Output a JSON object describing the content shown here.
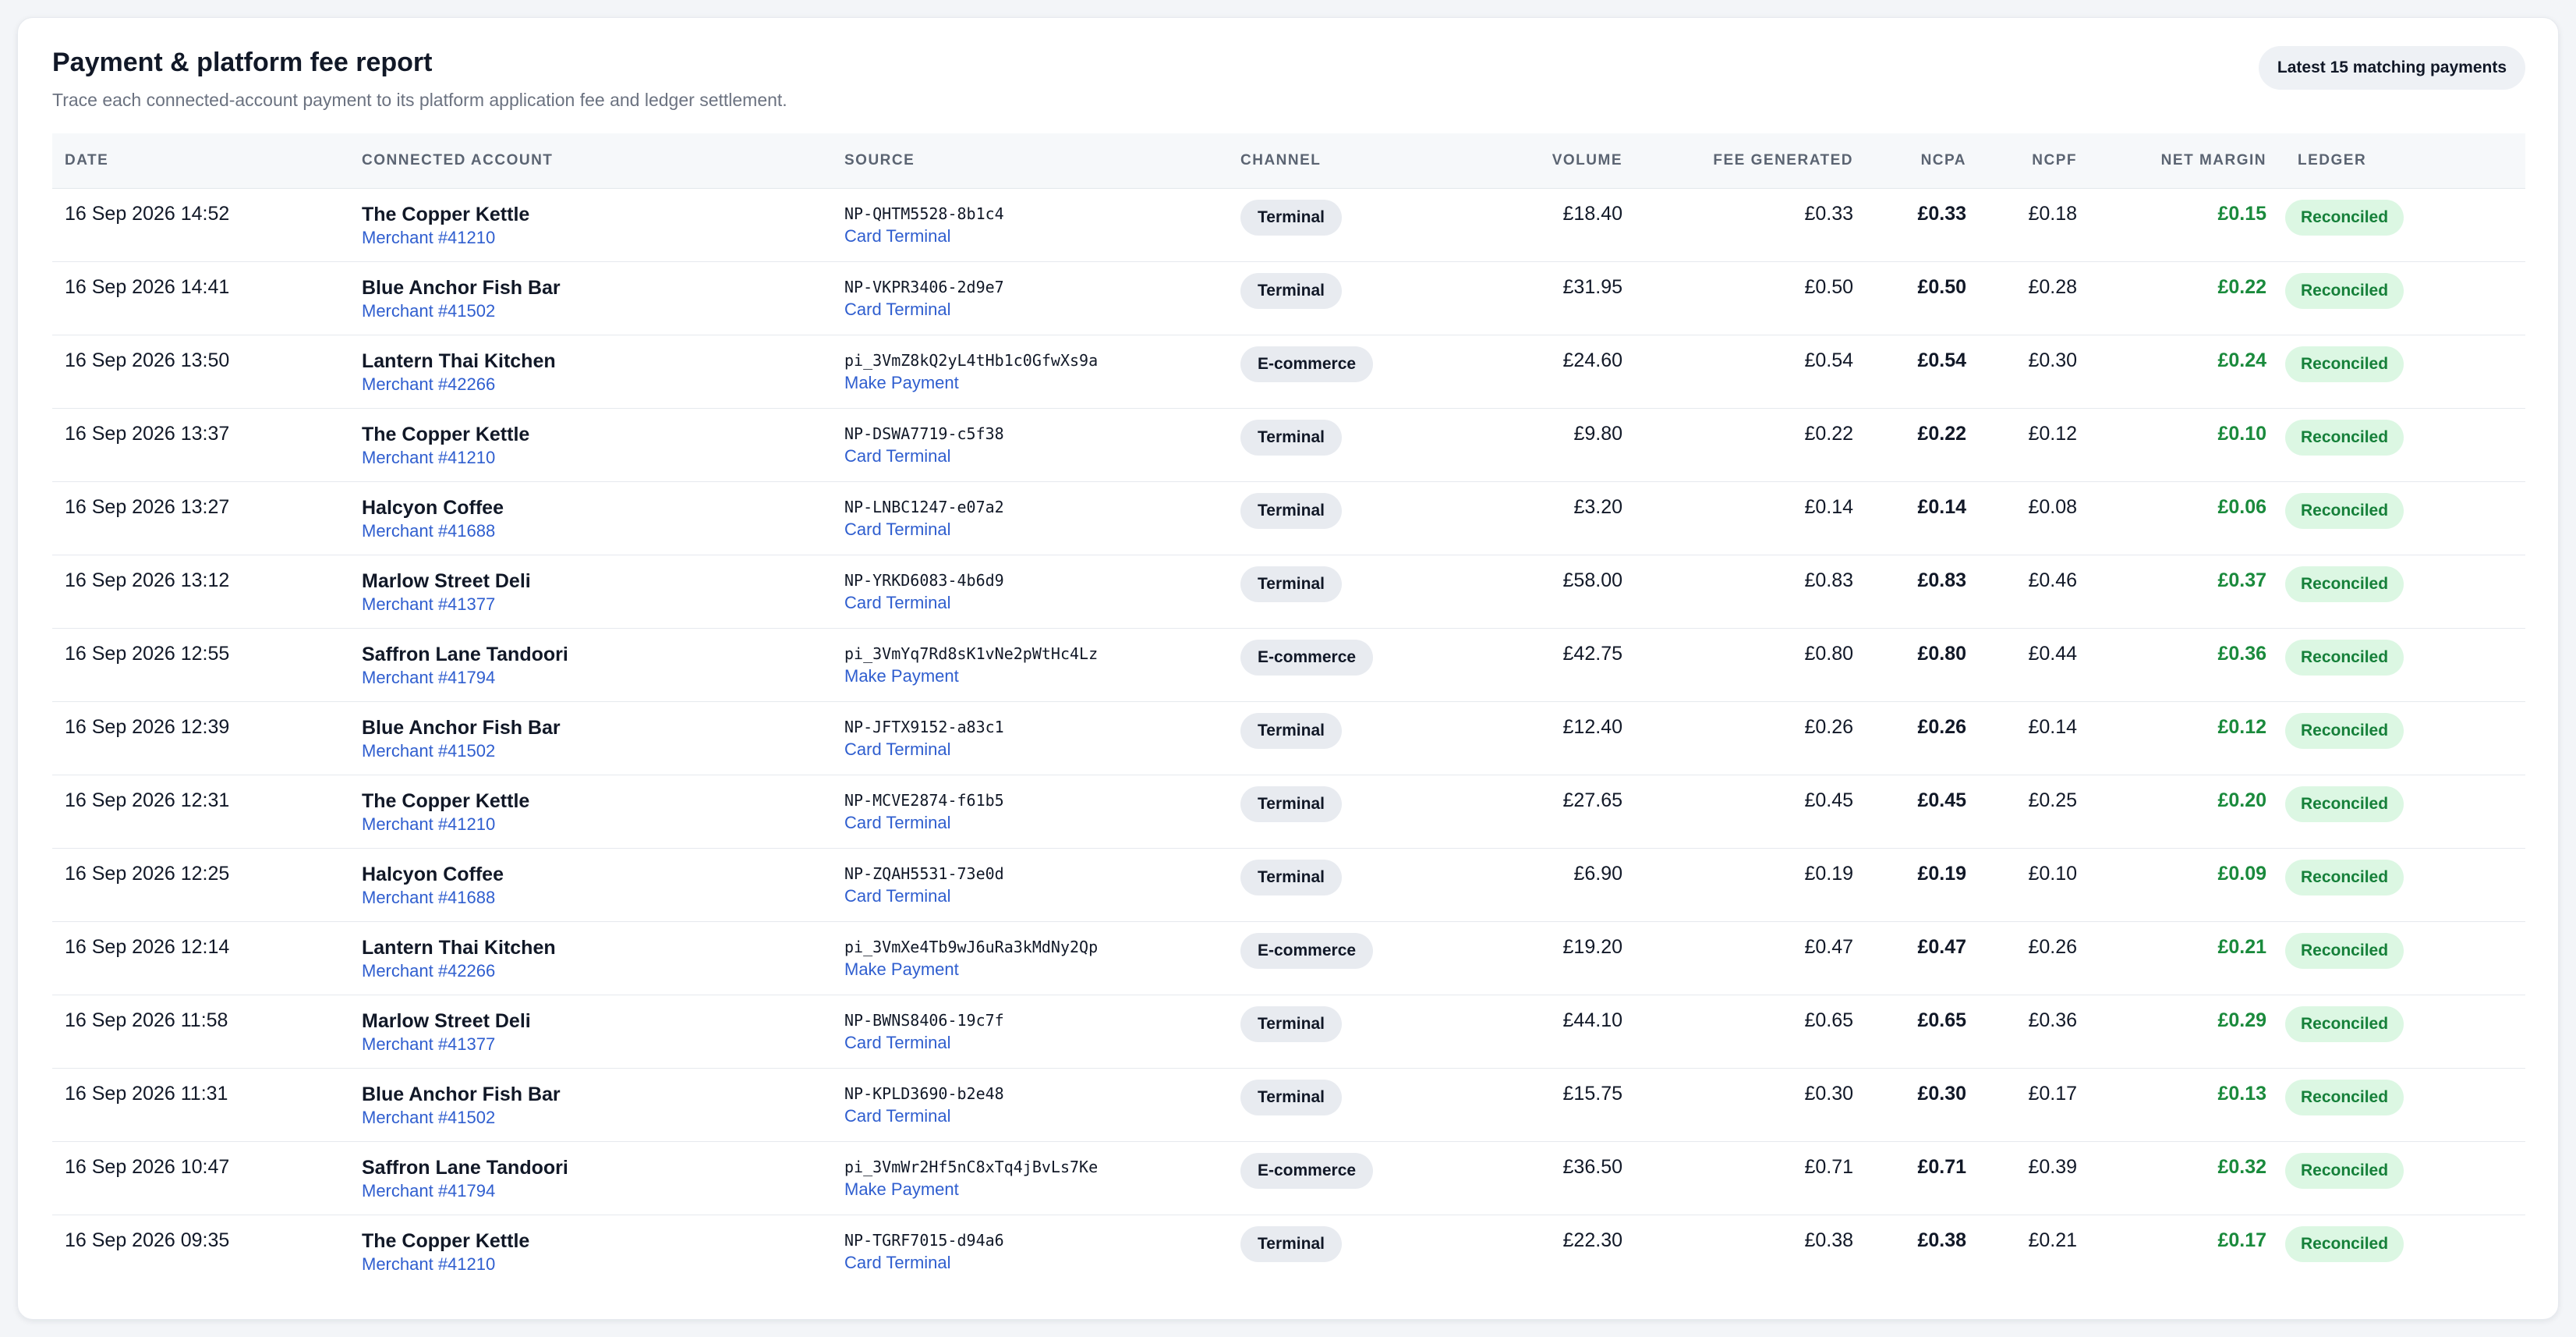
{
  "report": {
    "title": "Payment & platform fee report",
    "subtitle": "Trace each connected-account payment to its platform application fee and ledger settlement.",
    "filter_chip": "Latest 15 matching payments"
  },
  "colors": {
    "accent_link": "#2f5ecf",
    "positive": "#1a8a3c",
    "status_bg": "#dcf7e3"
  },
  "columns": {
    "date": "DATE",
    "account": "CONNECTED ACCOUNT",
    "source": "SOURCE",
    "channel": "CHANNEL",
    "volume": "VOLUME",
    "fee": "FEE GENERATED",
    "ncpa": "NCPA",
    "ncpf": "NCPF",
    "margin": "NET MARGIN",
    "ledger": "LEDGER"
  },
  "rows": [
    {
      "date": "16 Sep 2026 14:52",
      "account": "The Copper Kettle",
      "merchant": "Merchant #41210",
      "source_id": "NP-QHTM5528-8b1c4",
      "source_type": "Card Terminal",
      "channel": "Terminal",
      "volume": "£18.40",
      "fee": "£0.33",
      "ncpa": "£0.33",
      "ncpf": "£0.18",
      "margin": "£0.15",
      "ledger": "Reconciled"
    },
    {
      "date": "16 Sep 2026 14:41",
      "account": "Blue Anchor Fish Bar",
      "merchant": "Merchant #41502",
      "source_id": "NP-VKPR3406-2d9e7",
      "source_type": "Card Terminal",
      "channel": "Terminal",
      "volume": "£31.95",
      "fee": "£0.50",
      "ncpa": "£0.50",
      "ncpf": "£0.28",
      "margin": "£0.22",
      "ledger": "Reconciled"
    },
    {
      "date": "16 Sep 2026 13:50",
      "account": "Lantern Thai Kitchen",
      "merchant": "Merchant #42266",
      "source_id": "pi_3VmZ8kQ2yL4tHb1c0GfwXs9a",
      "source_type": "Make Payment",
      "channel": "E-commerce",
      "volume": "£24.60",
      "fee": "£0.54",
      "ncpa": "£0.54",
      "ncpf": "£0.30",
      "margin": "£0.24",
      "ledger": "Reconciled"
    },
    {
      "date": "16 Sep 2026 13:37",
      "account": "The Copper Kettle",
      "merchant": "Merchant #41210",
      "source_id": "NP-DSWA7719-c5f38",
      "source_type": "Card Terminal",
      "channel": "Terminal",
      "volume": "£9.80",
      "fee": "£0.22",
      "ncpa": "£0.22",
      "ncpf": "£0.12",
      "margin": "£0.10",
      "ledger": "Reconciled"
    },
    {
      "date": "16 Sep 2026 13:27",
      "account": "Halcyon Coffee",
      "merchant": "Merchant #41688",
      "source_id": "NP-LNBC1247-e07a2",
      "source_type": "Card Terminal",
      "channel": "Terminal",
      "volume": "£3.20",
      "fee": "£0.14",
      "ncpa": "£0.14",
      "ncpf": "£0.08",
      "margin": "£0.06",
      "ledger": "Reconciled"
    },
    {
      "date": "16 Sep 2026 13:12",
      "account": "Marlow Street Deli",
      "merchant": "Merchant #41377",
      "source_id": "NP-YRKD6083-4b6d9",
      "source_type": "Card Terminal",
      "channel": "Terminal",
      "volume": "£58.00",
      "fee": "£0.83",
      "ncpa": "£0.83",
      "ncpf": "£0.46",
      "margin": "£0.37",
      "ledger": "Reconciled"
    },
    {
      "date": "16 Sep 2026 12:55",
      "account": "Saffron Lane Tandoori",
      "merchant": "Merchant #41794",
      "source_id": "pi_3VmYq7Rd8sK1vNe2pWtHc4Lz",
      "source_type": "Make Payment",
      "channel": "E-commerce",
      "volume": "£42.75",
      "fee": "£0.80",
      "ncpa": "£0.80",
      "ncpf": "£0.44",
      "margin": "£0.36",
      "ledger": "Reconciled"
    },
    {
      "date": "16 Sep 2026 12:39",
      "account": "Blue Anchor Fish Bar",
      "merchant": "Merchant #41502",
      "source_id": "NP-JFTX9152-a83c1",
      "source_type": "Card Terminal",
      "channel": "Terminal",
      "volume": "£12.40",
      "fee": "£0.26",
      "ncpa": "£0.26",
      "ncpf": "£0.14",
      "margin": "£0.12",
      "ledger": "Reconciled"
    },
    {
      "date": "16 Sep 2026 12:31",
      "account": "The Copper Kettle",
      "merchant": "Merchant #41210",
      "source_id": "NP-MCVE2874-f61b5",
      "source_type": "Card Terminal",
      "channel": "Terminal",
      "volume": "£27.65",
      "fee": "£0.45",
      "ncpa": "£0.45",
      "ncpf": "£0.25",
      "margin": "£0.20",
      "ledger": "Reconciled"
    },
    {
      "date": "16 Sep 2026 12:25",
      "account": "Halcyon Coffee",
      "merchant": "Merchant #41688",
      "source_id": "NP-ZQAH5531-73e0d",
      "source_type": "Card Terminal",
      "channel": "Terminal",
      "volume": "£6.90",
      "fee": "£0.19",
      "ncpa": "£0.19",
      "ncpf": "£0.10",
      "margin": "£0.09",
      "ledger": "Reconciled"
    },
    {
      "date": "16 Sep 2026 12:14",
      "account": "Lantern Thai Kitchen",
      "merchant": "Merchant #42266",
      "source_id": "pi_3VmXe4Tb9wJ6uRa3kMdNy2Qp",
      "source_type": "Make Payment",
      "channel": "E-commerce",
      "volume": "£19.20",
      "fee": "£0.47",
      "ncpa": "£0.47",
      "ncpf": "£0.26",
      "margin": "£0.21",
      "ledger": "Reconciled"
    },
    {
      "date": "16 Sep 2026 11:58",
      "account": "Marlow Street Deli",
      "merchant": "Merchant #41377",
      "source_id": "NP-BWNS8406-19c7f",
      "source_type": "Card Terminal",
      "channel": "Terminal",
      "volume": "£44.10",
      "fee": "£0.65",
      "ncpa": "£0.65",
      "ncpf": "£0.36",
      "margin": "£0.29",
      "ledger": "Reconciled"
    },
    {
      "date": "16 Sep 2026 11:31",
      "account": "Blue Anchor Fish Bar",
      "merchant": "Merchant #41502",
      "source_id": "NP-KPLD3690-b2e48",
      "source_type": "Card Terminal",
      "channel": "Terminal",
      "volume": "£15.75",
      "fee": "£0.30",
      "ncpa": "£0.30",
      "ncpf": "£0.17",
      "margin": "£0.13",
      "ledger": "Reconciled"
    },
    {
      "date": "16 Sep 2026 10:47",
      "account": "Saffron Lane Tandoori",
      "merchant": "Merchant #41794",
      "source_id": "pi_3VmWr2Hf5nC8xTq4jBvLs7Ke",
      "source_type": "Make Payment",
      "channel": "E-commerce",
      "volume": "£36.50",
      "fee": "£0.71",
      "ncpa": "£0.71",
      "ncpf": "£0.39",
      "margin": "£0.32",
      "ledger": "Reconciled"
    },
    {
      "date": "16 Sep 2026 09:35",
      "account": "The Copper Kettle",
      "merchant": "Merchant #41210",
      "source_id": "NP-TGRF7015-d94a6",
      "source_type": "Card Terminal",
      "channel": "Terminal",
      "volume": "£22.30",
      "fee": "£0.38",
      "ncpa": "£0.38",
      "ncpf": "£0.21",
      "margin": "£0.17",
      "ledger": "Reconciled"
    }
  ]
}
